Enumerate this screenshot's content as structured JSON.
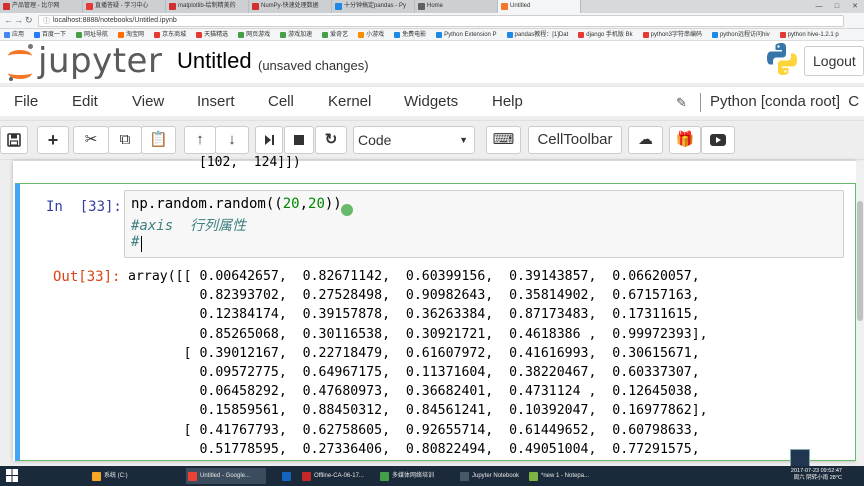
{
  "browser": {
    "tabs": [
      {
        "label": "产品管理 - 比尔网",
        "color": "#d32f2f",
        "active": false
      },
      {
        "label": "直播答疑 - 学习中心",
        "color": "#e53935",
        "active": false
      },
      {
        "label": "matplotlib-绘制精美的",
        "color": "#d32f2f",
        "active": false
      },
      {
        "label": "NumPy-快速处理数据",
        "color": "#d32f2f",
        "active": false
      },
      {
        "label": "十分钟搞定pandas - Py",
        "color": "#1e88e5",
        "active": false
      },
      {
        "label": "Home",
        "color": "#616161",
        "active": false
      },
      {
        "label": "Untitled",
        "color": "#f37726",
        "active": true
      }
    ],
    "window_controls": [
      "—",
      "□",
      "✕"
    ],
    "url": "localhost:8888/notebooks/Untitled.ipynb",
    "bookmarks": [
      {
        "label": "应用",
        "color": "#4285f4"
      },
      {
        "label": "百度一下",
        "color": "#2979ff"
      },
      {
        "label": "网址导航",
        "color": "#43a047"
      },
      {
        "label": "淘宝网",
        "color": "#ff6d00"
      },
      {
        "label": "京东商城",
        "color": "#e53935"
      },
      {
        "label": "天猫精选",
        "color": "#e53935"
      },
      {
        "label": "网页游戏",
        "color": "#43a047"
      },
      {
        "label": "游戏加速",
        "color": "#43a047"
      },
      {
        "label": "爱奇艺",
        "color": "#43a047"
      },
      {
        "label": "小游戏",
        "color": "#fb8c00"
      },
      {
        "label": "免费电影",
        "color": "#1e88e5"
      },
      {
        "label": "Python Extension P",
        "color": "#1e88e5"
      },
      {
        "label": "pandas教程：[1]Dat",
        "color": "#1e88e5"
      },
      {
        "label": "django 手机版 Bk",
        "color": "#e53935"
      },
      {
        "label": "python3字符串编码",
        "color": "#e53935"
      },
      {
        "label": "python远程访问hiv",
        "color": "#1e88e5"
      },
      {
        "label": "python hive-1.2.1 p",
        "color": "#e53935"
      }
    ]
  },
  "header": {
    "logo_text": "jupyter",
    "notebook_title": "Untitled",
    "save_status": "(unsaved changes)",
    "logout_label": "Logout"
  },
  "menubar": {
    "items": [
      "File",
      "Edit",
      "View",
      "Insert",
      "Cell",
      "Kernel",
      "Widgets",
      "Help"
    ],
    "kernel_name": "Python [conda root]",
    "kernel_circle": "C"
  },
  "toolbar": {
    "cell_type": "Code",
    "celltoolbar_label": "CellToolbar"
  },
  "notebook": {
    "previous_output_tail": "[102,  124]])",
    "cell": {
      "in_prompt": "In  [33]:",
      "code_fn": "np.random.random((",
      "code_arg1": "20",
      "code_comma": ",",
      "code_arg2": "20",
      "code_close": "))",
      "comment_line1": "#axis  行列属性",
      "comment_line2": "#",
      "out_prompt": "Out[33]:",
      "output_lines": [
        "array([[ 0.00642657,  0.82671142,  0.60399156,  0.39143857,  0.06620057,",
        "         0.82393702,  0.27528498,  0.90982643,  0.35814902,  0.67157163,",
        "         0.12384174,  0.39157878,  0.36263384,  0.87173483,  0.17311615,",
        "         0.85265068,  0.30116538,  0.30921721,  0.4618386 ,  0.99972393],",
        "       [ 0.39012167,  0.22718479,  0.61607972,  0.41616993,  0.30615671,",
        "         0.09572775,  0.64967175,  0.11371604,  0.38220467,  0.60337307,",
        "         0.06458292,  0.47680973,  0.36682401,  0.4731124 ,  0.12645038,",
        "         0.15859561,  0.88450312,  0.84561241,  0.10392047,  0.16977862],",
        "       [ 0.41767793,  0.62758605,  0.92655714,  0.61449652,  0.60798633,",
        "         0.51778595,  0.27336406,  0.80822494,  0.49051004,  0.77291575,"
      ]
    }
  },
  "taskbar": {
    "items": [
      {
        "label": "系统 (C:)",
        "color": "#f9a825"
      },
      {
        "label": "Untitled - Google...",
        "color": "#ea4335",
        "active": true
      },
      {
        "label": "",
        "color": "#1565c0"
      },
      {
        "label": "Offline-CA-06-17...",
        "color": "#c62828"
      },
      {
        "label": "多媒体网络培训",
        "color": "#43a047"
      },
      {
        "label": "Jupyter Notebook",
        "color": "#455a64"
      },
      {
        "label": "*new 1 - Notepa...",
        "color": "#7cb342"
      }
    ],
    "clock_time": "2017-07-23  09:52:47",
    "clock_sub": "周六 阴转小雨  28°C"
  }
}
